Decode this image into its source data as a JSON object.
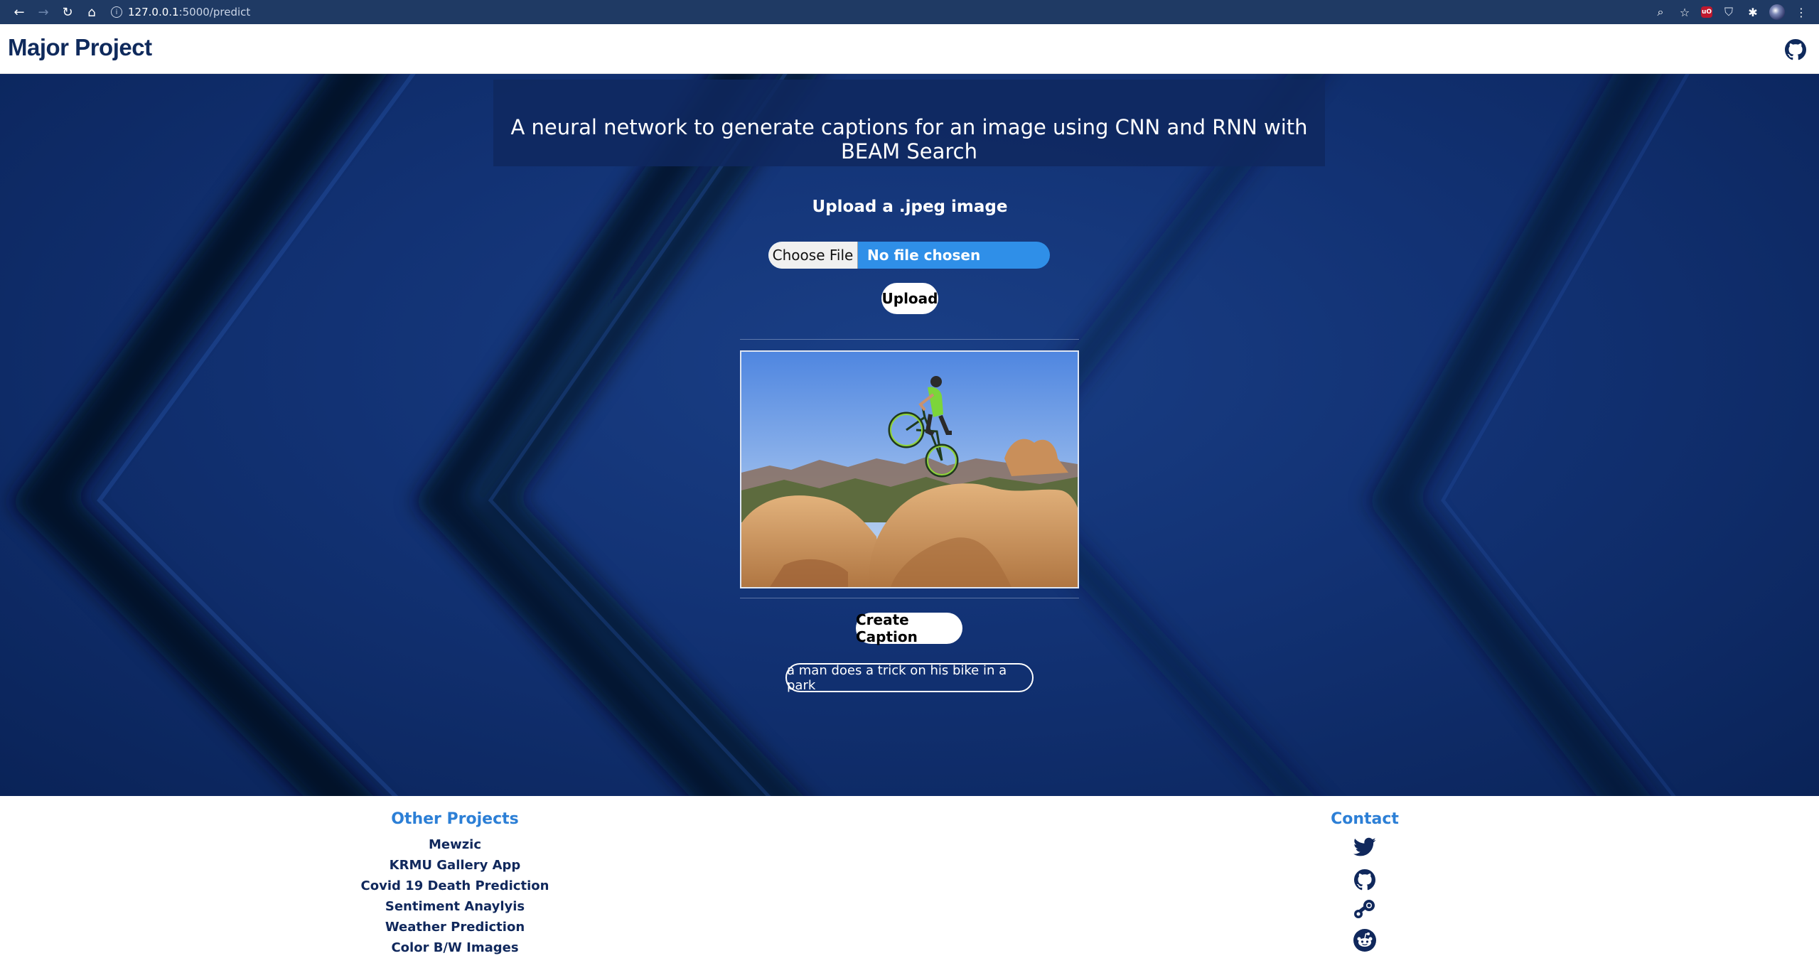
{
  "browser": {
    "url_host": "127.0.0.1",
    "url_path": ":5000/predict",
    "icons": [
      "back-arrow-icon",
      "forward-arrow-icon",
      "reload-icon",
      "home-icon",
      "site-info-icon",
      "zoom-icon",
      "bookmark-star-icon",
      "ublock-icon",
      "shield-icon",
      "extensions-icon",
      "profile-avatar-icon",
      "menu-kebab-icon"
    ]
  },
  "header": {
    "brand": "Major Project",
    "github_icon": "github-icon"
  },
  "hero": {
    "tagline": "A neural network to generate captions for an image using CNN and RNN with BEAM Search",
    "upload_title": "Upload a .jpeg image",
    "choose_file_label": "Choose File",
    "file_status": "No file chosen",
    "upload_label": "Upload",
    "create_caption_label": "Create Caption",
    "caption_result": "a man does a trick on his bike in a park"
  },
  "footer": {
    "projects_title": "Other Projects",
    "projects": [
      "Mewzic",
      "KRMU Gallery App",
      "Covid 19 Death Prediction",
      "Sentiment Anaylyis",
      "Weather Prediction",
      "Color B/W Images"
    ],
    "contact_title": "Contact",
    "contact_icons": [
      "twitter-icon",
      "github-icon",
      "steam-icon",
      "reddit-icon"
    ]
  },
  "colors": {
    "brand": "#0f2a5c",
    "accent": "#2c7fd6",
    "file_input": "#2f8fe8",
    "hero_background": "#123274"
  }
}
